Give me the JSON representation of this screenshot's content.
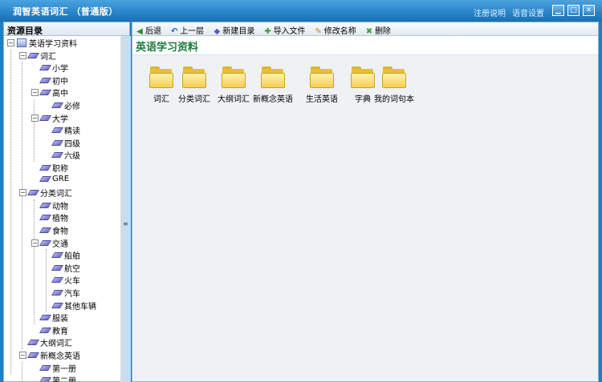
{
  "window": {
    "title": "润智英语词汇 （普通版）",
    "links": [
      "注册说明",
      "语音设置"
    ],
    "controls": {
      "minimize": "▁",
      "maximize": "□",
      "close": "✕"
    }
  },
  "sidebar": {
    "title": "资源目录",
    "tree": [
      {
        "label": "英语学习资料",
        "toggle": "⊟",
        "icon": "book"
      },
      {
        "label": "词汇",
        "toggle": "⊟"
      },
      {
        "label": "小学"
      },
      {
        "label": "初中"
      },
      {
        "label": "高中",
        "toggle": "⊟"
      },
      {
        "label": "必修"
      },
      {
        "label": "大学",
        "toggle": "⊟"
      },
      {
        "label": "精读"
      },
      {
        "label": "四级"
      },
      {
        "label": "六级"
      },
      {
        "label": "职称"
      },
      {
        "label": "GRE"
      },
      {
        "label": "分类词汇",
        "toggle": "⊟"
      },
      {
        "label": "动物"
      },
      {
        "label": "植物"
      },
      {
        "label": "食物"
      },
      {
        "label": "交通",
        "toggle": "⊟"
      },
      {
        "label": "船舶"
      },
      {
        "label": "航空"
      },
      {
        "label": "火车"
      },
      {
        "label": "汽车"
      },
      {
        "label": "其他车辆"
      },
      {
        "label": "服装"
      },
      {
        "label": "教育"
      },
      {
        "label": "大纲词汇"
      },
      {
        "label": "新概念英语",
        "toggle": "⊟"
      },
      {
        "label": "第一册"
      },
      {
        "label": "第二册"
      }
    ],
    "scroll_up": "▲",
    "splitter_grip": "≡"
  },
  "toolbar": {
    "back": "后退",
    "up": "上一层",
    "new_folder": "新建目录",
    "import": "导入文件",
    "rename": "修改名称",
    "delete": "删除",
    "icons": {
      "back": "◀",
      "up": "↶",
      "new_folder": "◆",
      "import": "✚",
      "rename": "✎",
      "delete": "✖"
    }
  },
  "main": {
    "heading": "英语学习资料",
    "folders": [
      "词汇",
      "分类词汇",
      "大纲词汇",
      "新概念英语",
      "生活英语",
      "字典",
      "我的词句本"
    ]
  }
}
